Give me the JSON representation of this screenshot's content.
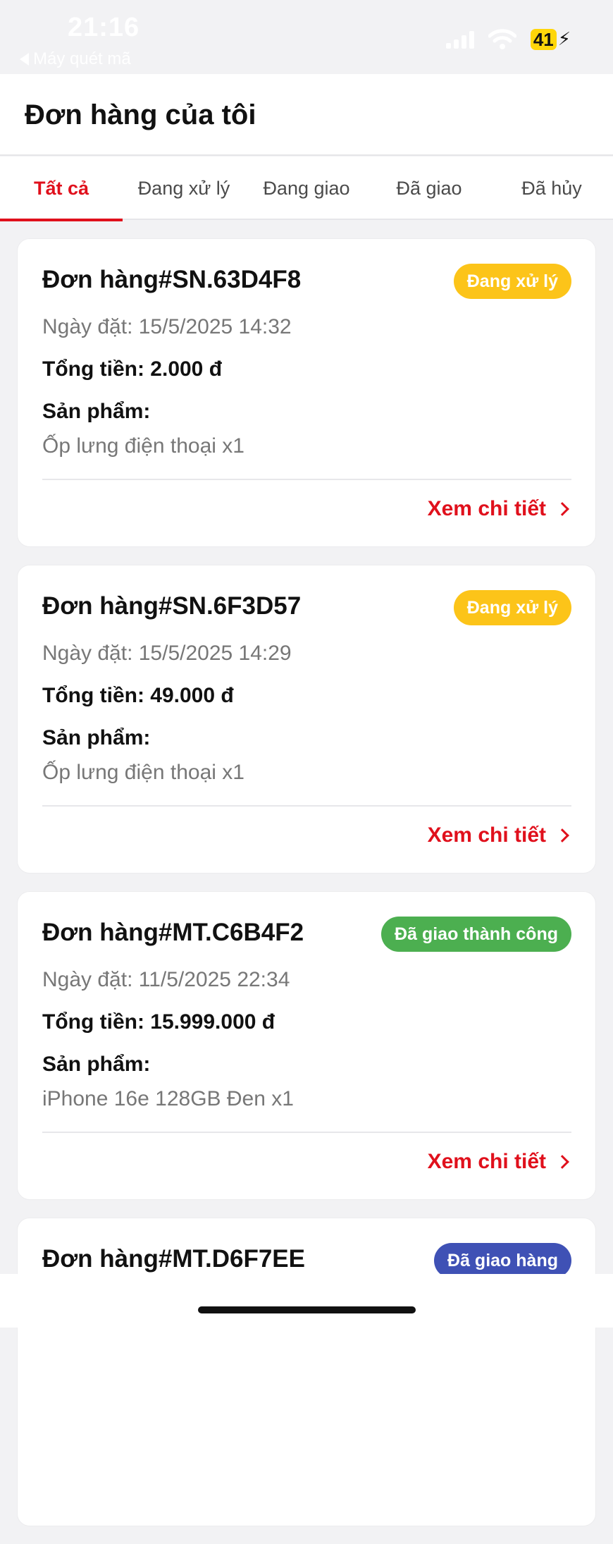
{
  "status_bar": {
    "time": "21:16",
    "back_label": "Máy quét mã",
    "battery": "41"
  },
  "header": {
    "title": "Đơn hàng của tôi"
  },
  "tabs": [
    {
      "label": "Tất cả",
      "active": true
    },
    {
      "label": "Đang xử lý",
      "active": false
    },
    {
      "label": "Đang giao",
      "active": false
    },
    {
      "label": "Đã giao",
      "active": false
    },
    {
      "label": "Đã hủy",
      "active": false
    }
  ],
  "orders": [
    {
      "id": "Đơn hàng#SN.63D4F8",
      "status": "Đang xử lý",
      "status_color": "#fcc419",
      "date": "Ngày đặt: 15/5/2025 14:32",
      "total": "Tổng tiền: 2.000 đ",
      "products_label": "Sản phẩm:",
      "product": "Ốp lưng điện thoại x1",
      "detail_label": "Xem chi tiết"
    },
    {
      "id": "Đơn hàng#SN.6F3D57",
      "status": "Đang xử lý",
      "status_color": "#fcc419",
      "date": "Ngày đặt: 15/5/2025 14:29",
      "total": "Tổng tiền: 49.000 đ",
      "products_label": "Sản phẩm:",
      "product": "Ốp lưng điện thoại x1",
      "detail_label": "Xem chi tiết"
    },
    {
      "id": "Đơn hàng#MT.C6B4F2",
      "status": "Đã giao thành công",
      "status_color": "#4caf50",
      "date": "Ngày đặt: 11/5/2025 22:34",
      "total": "Tổng tiền: 15.999.000 đ",
      "products_label": "Sản phẩm:",
      "product": "iPhone 16e 128GB Đen x1",
      "detail_label": "Xem chi tiết"
    },
    {
      "id": "Đơn hàng#MT.D6F7EE",
      "status": "Đã giao hàng",
      "status_color": "#3f51b5"
    }
  ],
  "colors": {
    "accent": "#e0101c",
    "background": "#f2f2f4"
  }
}
